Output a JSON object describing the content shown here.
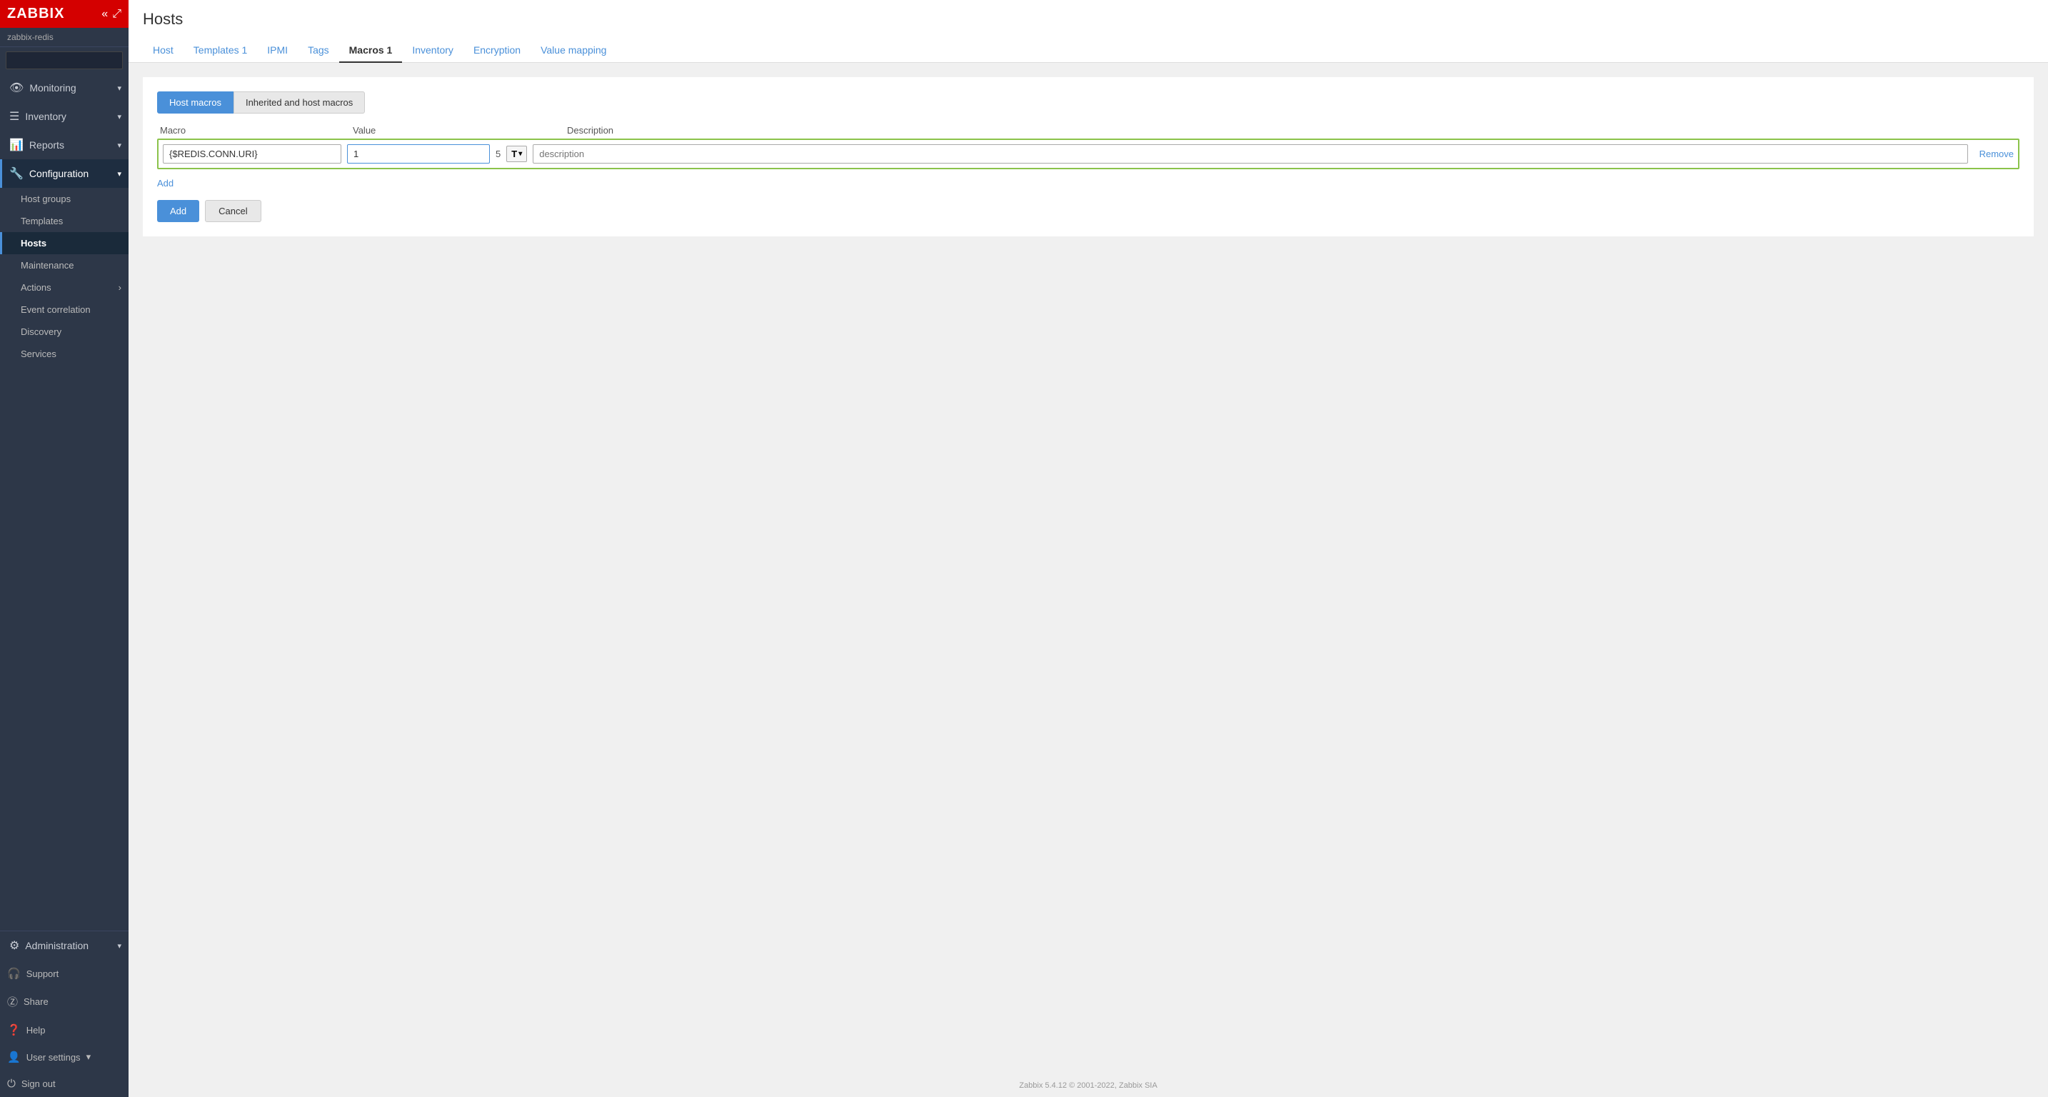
{
  "sidebar": {
    "logo": "ZABBIX",
    "user": "zabbix-redis",
    "search_placeholder": "",
    "nav_items": [
      {
        "id": "monitoring",
        "label": "Monitoring",
        "icon": "👁",
        "has_chevron": true
      },
      {
        "id": "inventory",
        "label": "Inventory",
        "icon": "☰",
        "has_chevron": true
      },
      {
        "id": "reports",
        "label": "Reports",
        "icon": "📊",
        "has_chevron": true
      },
      {
        "id": "configuration",
        "label": "Configuration",
        "icon": "🔧",
        "has_chevron": true,
        "active": true
      }
    ],
    "config_sub_items": [
      {
        "id": "host-groups",
        "label": "Host groups"
      },
      {
        "id": "templates",
        "label": "Templates"
      },
      {
        "id": "hosts",
        "label": "Hosts",
        "active": true
      },
      {
        "id": "maintenance",
        "label": "Maintenance"
      },
      {
        "id": "actions",
        "label": "Actions",
        "has_arrow": true
      },
      {
        "id": "event-correlation",
        "label": "Event correlation"
      },
      {
        "id": "discovery",
        "label": "Discovery"
      },
      {
        "id": "services",
        "label": "Services"
      }
    ],
    "bottom_items": [
      {
        "id": "administration",
        "label": "Administration",
        "icon": "⚙",
        "has_chevron": true
      },
      {
        "id": "support",
        "label": "Support",
        "icon": "?"
      },
      {
        "id": "share",
        "label": "Share",
        "icon": "Z"
      },
      {
        "id": "help",
        "label": "Help",
        "icon": "?"
      },
      {
        "id": "user-settings",
        "label": "User settings",
        "icon": "👤",
        "has_chevron": true
      },
      {
        "id": "sign-out",
        "label": "Sign out",
        "icon": "⏻"
      }
    ]
  },
  "page": {
    "title": "Hosts",
    "tabs": [
      {
        "id": "host",
        "label": "Host"
      },
      {
        "id": "templates",
        "label": "Templates 1"
      },
      {
        "id": "ipmi",
        "label": "IPMI"
      },
      {
        "id": "tags",
        "label": "Tags"
      },
      {
        "id": "macros",
        "label": "Macros 1",
        "active": true
      },
      {
        "id": "inventory",
        "label": "Inventory"
      },
      {
        "id": "encryption",
        "label": "Encryption"
      },
      {
        "id": "value-mapping",
        "label": "Value mapping"
      }
    ]
  },
  "macro_section": {
    "toggle_buttons": [
      {
        "id": "host-macros",
        "label": "Host macros",
        "active": true
      },
      {
        "id": "inherited-macros",
        "label": "Inherited and host macros",
        "active": false
      }
    ],
    "table_headers": {
      "macro": "Macro",
      "value": "Value",
      "description": "Description"
    },
    "macro_row": {
      "macro_value": "{$REDIS.CONN.URI}",
      "value": "1",
      "value_extra": "5",
      "type_label": "T",
      "description_placeholder": "description"
    },
    "add_link": "Add",
    "buttons": {
      "add": "Add",
      "cancel": "Cancel"
    }
  },
  "footer": {
    "text": "Zabbix 5.4.12 © 2001-2022, Zabbix SIA"
  }
}
